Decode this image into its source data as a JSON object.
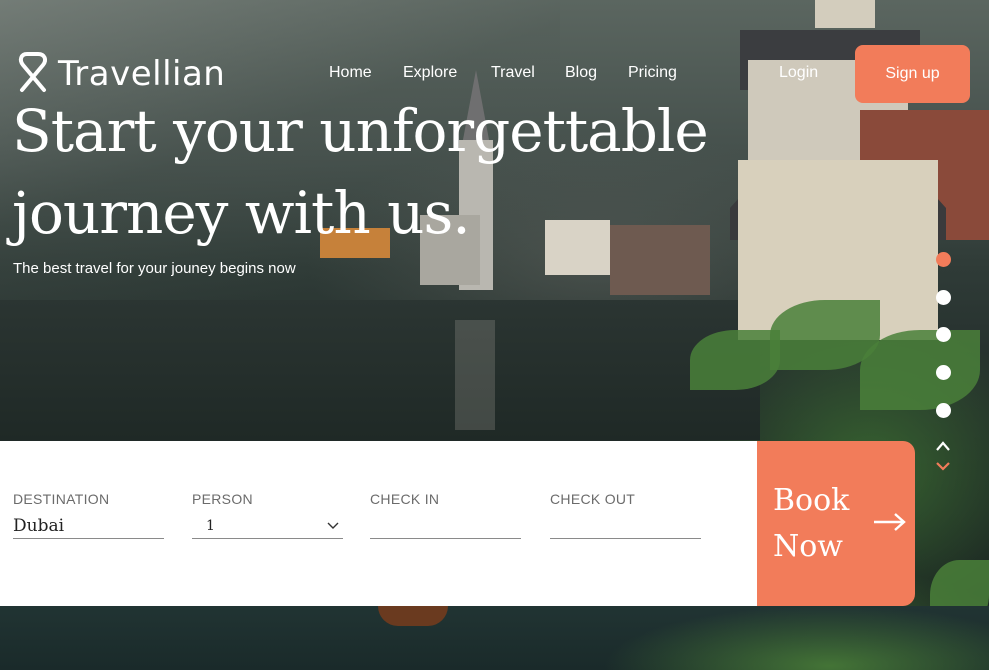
{
  "brand": {
    "name": "Travellian"
  },
  "nav": {
    "items": [
      {
        "label": "Home"
      },
      {
        "label": "Explore"
      },
      {
        "label": "Travel"
      },
      {
        "label": "Blog"
      },
      {
        "label": "Pricing"
      }
    ],
    "login_label": "Login",
    "signup_label": "Sign up"
  },
  "hero": {
    "headline_line1": "Start your unforgettable",
    "headline_line2": "journey with us.",
    "subline": "The best travel for your jouney begins now"
  },
  "slider": {
    "dots": 5,
    "active_index": 0
  },
  "booking": {
    "destination": {
      "label": "DESTINATION",
      "value": "Dubai"
    },
    "person": {
      "label": "PERSON",
      "value": "1"
    },
    "check_in": {
      "label": "CHECK IN",
      "value": ""
    },
    "check_out": {
      "label": "CHECK OUT",
      "value": ""
    },
    "book_label_line1": "Book",
    "book_label_line2": "Now"
  },
  "colors": {
    "accent": "#f27c5a",
    "white": "#ffffff"
  },
  "icons": {
    "logo": "travellian-logo-icon",
    "select": "chevron-down-icon",
    "book": "arrow-right-icon",
    "slider_up": "chevron-up-icon",
    "slider_down": "chevron-down-icon"
  }
}
